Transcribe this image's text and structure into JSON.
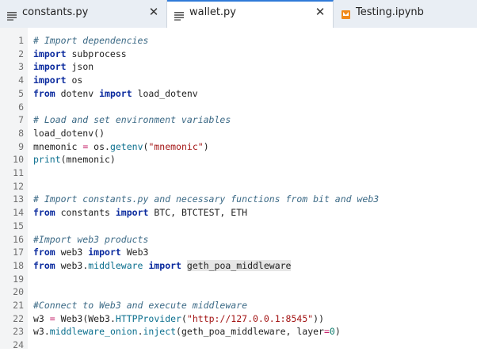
{
  "tabs": [
    {
      "label": "constants.py",
      "icon": "python-file-icon",
      "close": "✕",
      "active": false
    },
    {
      "label": "wallet.py",
      "icon": "python-file-icon",
      "close": "✕",
      "active": true
    },
    {
      "label": "Testing.ipynb",
      "icon": "notebook-icon",
      "active": false
    }
  ],
  "lines": [
    {
      "n": "1",
      "t": [
        {
          "c": "comment",
          "v": "# Import dependencies"
        }
      ]
    },
    {
      "n": "2",
      "t": [
        {
          "c": "kw",
          "v": "import"
        },
        {
          "c": "plain",
          "v": " subprocess"
        }
      ]
    },
    {
      "n": "3",
      "t": [
        {
          "c": "kw",
          "v": "import"
        },
        {
          "c": "plain",
          "v": " json"
        }
      ]
    },
    {
      "n": "4",
      "t": [
        {
          "c": "kw",
          "v": "import"
        },
        {
          "c": "plain",
          "v": " os"
        }
      ]
    },
    {
      "n": "5",
      "t": [
        {
          "c": "kw",
          "v": "from"
        },
        {
          "c": "plain",
          "v": " dotenv "
        },
        {
          "c": "kw",
          "v": "import"
        },
        {
          "c": "plain",
          "v": " load_dotenv"
        }
      ]
    },
    {
      "n": "6",
      "t": []
    },
    {
      "n": "7",
      "t": [
        {
          "c": "comment",
          "v": "# Load and set environment variables"
        }
      ]
    },
    {
      "n": "8",
      "t": [
        {
          "c": "plain",
          "v": "load_dotenv()"
        }
      ]
    },
    {
      "n": "9",
      "t": [
        {
          "c": "plain",
          "v": "mnemonic "
        },
        {
          "c": "op",
          "v": "="
        },
        {
          "c": "plain",
          "v": " os."
        },
        {
          "c": "attr",
          "v": "getenv"
        },
        {
          "c": "plain",
          "v": "("
        },
        {
          "c": "str",
          "v": "\"mnemonic\""
        },
        {
          "c": "plain",
          "v": ")"
        }
      ]
    },
    {
      "n": "10",
      "t": [
        {
          "c": "attr",
          "v": "print"
        },
        {
          "c": "plain",
          "v": "(mnemonic)"
        }
      ]
    },
    {
      "n": "11",
      "t": []
    },
    {
      "n": "12",
      "t": []
    },
    {
      "n": "13",
      "t": [
        {
          "c": "comment",
          "v": "# Import constants.py and necessary functions from bit and web3"
        }
      ]
    },
    {
      "n": "14",
      "t": [
        {
          "c": "kw",
          "v": "from"
        },
        {
          "c": "plain",
          "v": " constants "
        },
        {
          "c": "kw",
          "v": "import"
        },
        {
          "c": "plain",
          "v": " BTC, BTCTEST, ETH"
        }
      ]
    },
    {
      "n": "15",
      "t": []
    },
    {
      "n": "16",
      "t": [
        {
          "c": "comment",
          "v": "#Import web3 products"
        }
      ]
    },
    {
      "n": "17",
      "t": [
        {
          "c": "kw",
          "v": "from"
        },
        {
          "c": "plain",
          "v": " web3 "
        },
        {
          "c": "kw",
          "v": "import"
        },
        {
          "c": "plain",
          "v": " Web3"
        }
      ]
    },
    {
      "n": "18",
      "t": [
        {
          "c": "kw",
          "v": "from"
        },
        {
          "c": "plain",
          "v": " web3."
        },
        {
          "c": "attr",
          "v": "middleware"
        },
        {
          "c": "plain",
          "v": " "
        },
        {
          "c": "kw",
          "v": "import"
        },
        {
          "c": "plain",
          "v": " "
        },
        {
          "c": "hl plain",
          "v": "geth_poa_middleware"
        }
      ]
    },
    {
      "n": "19",
      "t": []
    },
    {
      "n": "20",
      "t": []
    },
    {
      "n": "21",
      "t": [
        {
          "c": "comment",
          "v": "#Connect to Web3 and execute middleware"
        }
      ]
    },
    {
      "n": "22",
      "t": [
        {
          "c": "plain",
          "v": "w3 "
        },
        {
          "c": "op",
          "v": "="
        },
        {
          "c": "plain",
          "v": " Web3(Web3."
        },
        {
          "c": "attr",
          "v": "HTTPProvider"
        },
        {
          "c": "plain",
          "v": "("
        },
        {
          "c": "str",
          "v": "\"http://127.0.0.1:8545\""
        },
        {
          "c": "plain",
          "v": "))"
        }
      ]
    },
    {
      "n": "23",
      "t": [
        {
          "c": "plain",
          "v": "w3."
        },
        {
          "c": "attr",
          "v": "middleware_onion"
        },
        {
          "c": "plain",
          "v": "."
        },
        {
          "c": "attr",
          "v": "inject"
        },
        {
          "c": "plain",
          "v": "(geth_poa_middleware, layer"
        },
        {
          "c": "op",
          "v": "="
        },
        {
          "c": "num",
          "v": "0"
        },
        {
          "c": "plain",
          "v": ")"
        }
      ]
    },
    {
      "n": "24",
      "t": []
    }
  ]
}
